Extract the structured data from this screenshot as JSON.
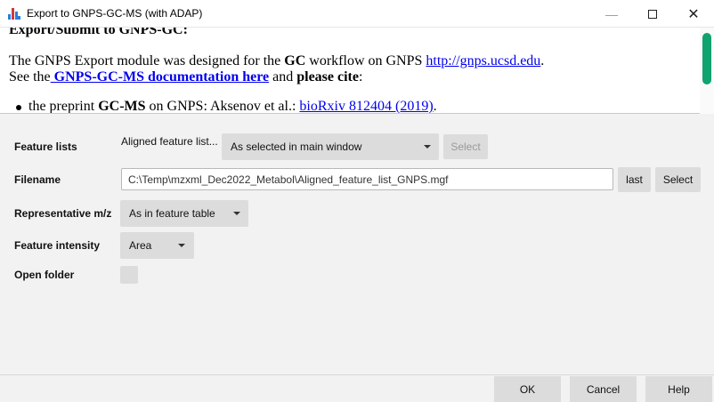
{
  "window": {
    "title": "Export to GNPS-GC-MS (with ADAP)",
    "minimize_glyph": "—",
    "close_glyph": "✕",
    "icon": "chart-app-icon"
  },
  "help": {
    "heading": "Export/Submit to GNPS-GC:",
    "line1_a": "The GNPS Export module was designed for the ",
    "line1_b": "GC",
    "line1_c": " workflow on GNPS ",
    "line1_link": "http://gnps.ucsd.edu",
    "line1_end": ".",
    "line2_a": "See the",
    "line2_link": " GNPS-GC-MS documentation here",
    "line2_b": " and ",
    "line2_c": "please cite",
    "line2_end": ":",
    "bullet_a": "the preprint ",
    "bullet_b": "GC-MS",
    "bullet_c": " on GNPS: Aksenov et al.: ",
    "bullet_link": "bioRxiv 812404 (2019)",
    "bullet_end": "."
  },
  "form": {
    "feature_lists": {
      "label": "Feature lists",
      "current": "Aligned feature list...",
      "combo_value": "As selected in main window",
      "select_button": "Select"
    },
    "filename": {
      "label": "Filename",
      "value": "C:\\Temp\\mzxml_Dec2022_Metabol\\Aligned_feature_list_GNPS.mgf",
      "last_button": "last",
      "select_button": "Select"
    },
    "representative_mz": {
      "label": "Representative m/z",
      "combo_value": "As in feature table"
    },
    "feature_intensity": {
      "label": "Feature intensity",
      "combo_value": "Area"
    },
    "open_folder": {
      "label": "Open folder",
      "checked": false
    }
  },
  "footer": {
    "ok": "OK",
    "cancel": "Cancel",
    "help": "Help"
  },
  "colors": {
    "scroll_thumb": "#10a36f",
    "link": "#0000ee",
    "button_bg": "#dcdcdc"
  }
}
